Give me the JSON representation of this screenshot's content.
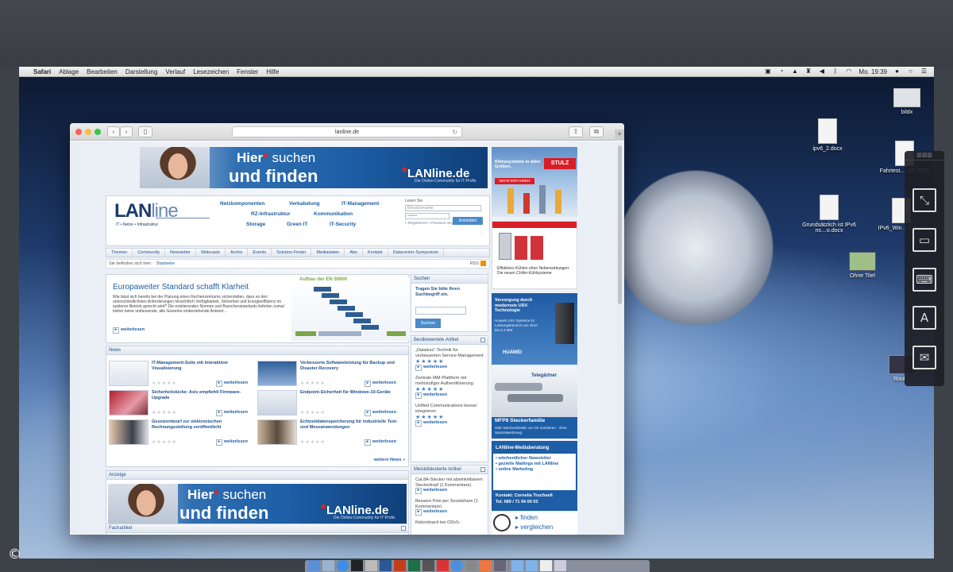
{
  "menubar": {
    "app": "Safari",
    "items": [
      "Ablage",
      "Bearbeiten",
      "Darstellung",
      "Verlauf",
      "Lesezeichen",
      "Fenster",
      "Hilfe"
    ],
    "clock": "Mo. 19:39"
  },
  "desktop_icons": [
    {
      "label": "bildx"
    },
    {
      "label": "ipv6_2.docx"
    },
    {
      "label": "Fahrtest… UG 2015"
    },
    {
      "label": "Grundsätzlich ist IPv6 ns…o.docx"
    },
    {
      "label": "IPv6_Win… ll.docx"
    },
    {
      "label": "Ohne Titel"
    },
    {
      "label": "Rout…"
    }
  ],
  "browser": {
    "url": "lanline.de"
  },
  "banner": {
    "line1_a": "Hier",
    "line1_b": "suchen",
    "line2": "und finden",
    "logo": "LANline.de",
    "logo_sub": "Die Online-Community für IT-Profis"
  },
  "site": {
    "logo_main": "LAN",
    "logo_rest": "line",
    "logo_sub": "IT • Netze • Infrastruktur",
    "topnav": [
      "Netzkomponenten",
      "Verkabelung",
      "IT-Management",
      "RZ-Infrastruktur",
      "Kommunikation",
      "Storage",
      "Green IT",
      "IT-Security"
    ],
    "login": {
      "label": "Lesen Sie",
      "user_placeholder": "Benutzername",
      "pass_placeholder": "•••••••",
      "button": "Anmelden",
      "links": "» Registrieren  » Passwort vergessen"
    },
    "mainnav": [
      "Themen",
      "Community",
      "Newsletter",
      "Webcasts",
      "Archiv",
      "Events",
      "Solution-Finder",
      "Mediadaten",
      "Abo",
      "Kontakt",
      "Datacenter-Symposium"
    ],
    "breadcrumb_label": "Sie befinden sich hier:",
    "breadcrumb_link": "Startseite",
    "rss": "RSS"
  },
  "feature": {
    "title": "Europaweiter Standard schafft Klarheit",
    "text": "Wie lässt sich bereits bei der Planung eines Rechenzentrums sicherstellen, dass es den unterschiedlichsten Anforderungen hinsichtlich Verfügbarkeit, Sicherheit und Energieeffizienz im späteren Betrieb gerecht wird? Die existierenden Normen und Branchenstandards lieferten zumal bisher keine umfassende, alle Gewerke einbeziehende Antwort…",
    "more": "weiterlesen",
    "diagram_title": "Aufbau der EN 50600"
  },
  "news": {
    "heading": "News",
    "items": [
      {
        "title": "IT-Management-Suite mit interaktiver Visualisierung",
        "more": "weiterlesen"
      },
      {
        "title": "Verbesserte Softwareleistung für Backup und Disaster Recovery",
        "more": "weiterlesen"
      },
      {
        "title": "Sicherheitslücke: Axis empfiehlt Firmware-Upgrade",
        "more": "weiterlesen"
      },
      {
        "title": "Endpoint-Sicherheit für Windows-10-Geräte",
        "more": "weiterlesen"
      },
      {
        "title": "Gesetzentwurf zur elektronischen Rechnungsstellung veröffentlicht",
        "more": "weiterlesen"
      },
      {
        "title": "Echtzeitdatenspeicherung für industrielle Text- und Messanwendungen",
        "more": "weiterlesen"
      }
    ],
    "all": "weitere News »"
  },
  "anzeige": {
    "heading": "Anzeige"
  },
  "fachartikel": {
    "heading": "Fachartikel"
  },
  "search_box": {
    "heading": "Suchen",
    "prompt": "Tragen Sie bitte Ihren Suchbegriff ein.",
    "button": "Suchen"
  },
  "best_rated": {
    "heading": "Bestbewertete Artikel",
    "items": [
      {
        "text": "„Dataless“-Technik für verbesserten Service-Management",
        "more": "weiterlesen"
      },
      {
        "text": "Zentrale IAM-Plattform mit mehrstufiger Authentifizierung",
        "more": "weiterlesen"
      },
      {
        "text": "Unified Communications besser integrieren",
        "more": "weiterlesen"
      }
    ]
  },
  "most_discussed": {
    "heading": "Meistdiskutierte Artikel",
    "items": [
      {
        "text": "Cat.8A-Stecker mit abwinkelbarem Steckerkopf (1 Kommentare)",
        "more": "weiterlesen"
      },
      {
        "text": "Bessere Pole per Socialshare (1 Kommentare)",
        "more": "weiterlesen"
      },
      {
        "text": "Rekordnach bei ODvS-"
      }
    ]
  },
  "ads": {
    "stulz_text": "Klimasysteme in allen Größen.",
    "stulz_brand": "STULZ",
    "stulz_cta": "MEHR ERFAHREN",
    "rittal_text": "Effektives Kühlen ohne Nebenwirkungen: Die neuen Chiller-Kühlsysteme",
    "huawei_title": "Versorgung durch modernste USV-Technologie",
    "huawei_text": "Huawei USV Systeme im Leistungsbereich von 1kVA bis 0,4 MW",
    "huawei_brand": "HUAWEI",
    "tg_brand": "Telegärtner",
    "tg_title": "MFP8 Steckerfamilie",
    "tg_text": "GbE-Steckverbinder vor Ort montieren - ohne Spezialwerkzeug",
    "media_title": "LANline-Mediaberatung",
    "media_items": [
      "wöchentlicher Newsletter",
      "gezielte Mailings mit LANline",
      "online Marketing"
    ],
    "media_contact": "Kontakt: Cornelia Truchseß",
    "media_phone": "Tel. 089 / 71 94 00 03",
    "finden_1": "finden",
    "finden_2": "vergleichen"
  },
  "colors": {
    "accent": "#1d5ea6",
    "rating": "#4a7fc0"
  }
}
